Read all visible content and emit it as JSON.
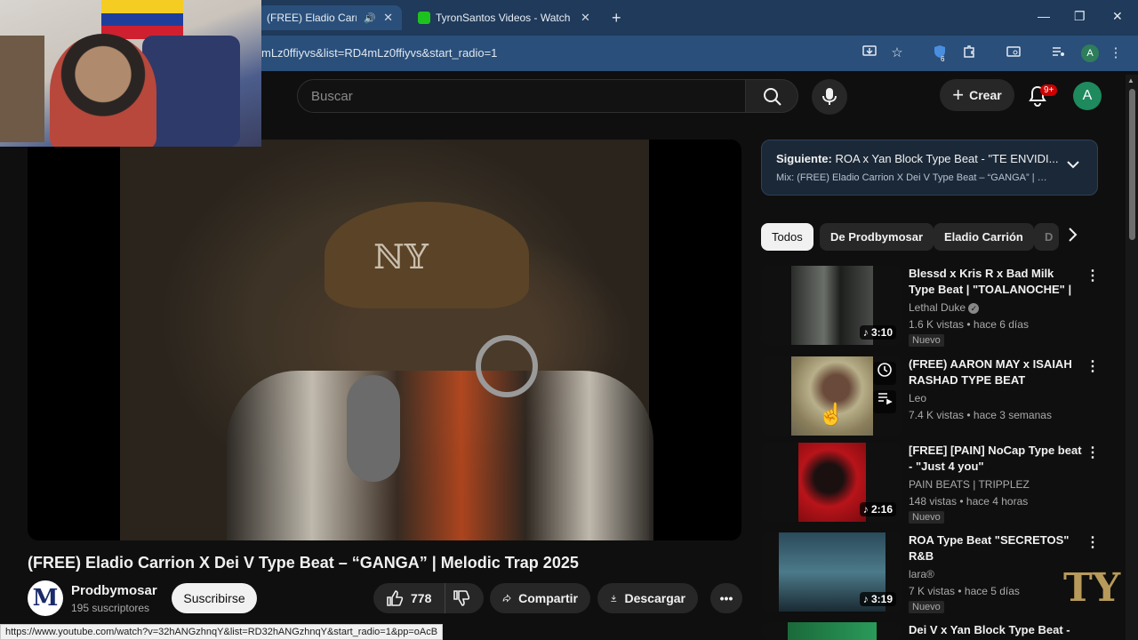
{
  "browser": {
    "tabs": [
      {
        "label": "(FREE) Eladio Carrion X",
        "active": true,
        "audio": "🔊",
        "close": "✕"
      },
      {
        "label": "TyronSantos Videos - Watch Or",
        "active": false,
        "close": "✕"
      }
    ],
    "new_tab": "+",
    "window_controls": {
      "minimize": "—",
      "maximize": "❐",
      "close": "✕"
    },
    "url": "mLz0ffiyvs&list=RD4mLz0ffiyvs&start_radio=1",
    "extensions_badge": "6",
    "profile_initial": "A"
  },
  "header": {
    "search_placeholder": "Buscar",
    "create_label": "Crear",
    "notifications_badge": "9+",
    "avatar_initial": "A"
  },
  "video": {
    "title": "(FREE) Eladio Carrion X Dei V Type Beat – “GANGA” | Melodic Trap 2025",
    "channel": "Prodbymosar",
    "channel_logo": "M",
    "subscribers": "195 suscriptores",
    "subscribe_label": "Suscribirse",
    "likes": "778",
    "share_label": "Compartir",
    "download_label": "Descargar",
    "more": "•••"
  },
  "status_url": "https://www.youtube.com/watch?v=32hANGzhnqY&list=RD32hANGzhnqY&start_radio=1&pp=oAcB",
  "up_next": {
    "label": "Siguiente:",
    "title": "ROA x Yan Block Type Beat - \"TE ENVIDI...",
    "mix": "Mix: (FREE) Eladio Carrion X Dei V Type Beat – “GANGA” | Melodic"
  },
  "chips": [
    "Todos",
    "De Prodbymosar",
    "Eladio Carrión",
    "D"
  ],
  "recommendations": [
    {
      "title": "Blessd x Kris R x Bad Milk Type Beat | \"TOALANOCHE\" | Afro x ...",
      "channel": "Lethal Duke",
      "verified": true,
      "meta": "1.6 K vistas • hace 6 días",
      "badge": "Nuevo",
      "duration": "3:10"
    },
    {
      "title": "(FREE) AARON MAY x ISAIAH RASHAD TYPE BEAT \"ECHOES...",
      "channel": "Leo",
      "verified": false,
      "meta": "7.4 K vistas • hace 3 semanas",
      "badge": "",
      "duration": ""
    },
    {
      "title": "[FREE] [PAIN] NoCap Type beat - \"Just 4 you\"",
      "channel": "PAIN BEATS | TRIPPLEZ",
      "verified": false,
      "meta": "148 vistas • hace 4 horas",
      "badge": "Nuevo",
      "duration": "2:16"
    },
    {
      "title": "ROA Type Beat \"SECRETOS\" R&B",
      "channel": "lara®",
      "verified": false,
      "meta": "7 K vistas • hace 5 días",
      "badge": "Nuevo",
      "duration": "3:19"
    },
    {
      "title": "Dei V x Yan Block Type Beat -",
      "channel": "",
      "verified": false,
      "meta": "",
      "badge": "",
      "duration": ""
    }
  ],
  "watermark": "TY"
}
